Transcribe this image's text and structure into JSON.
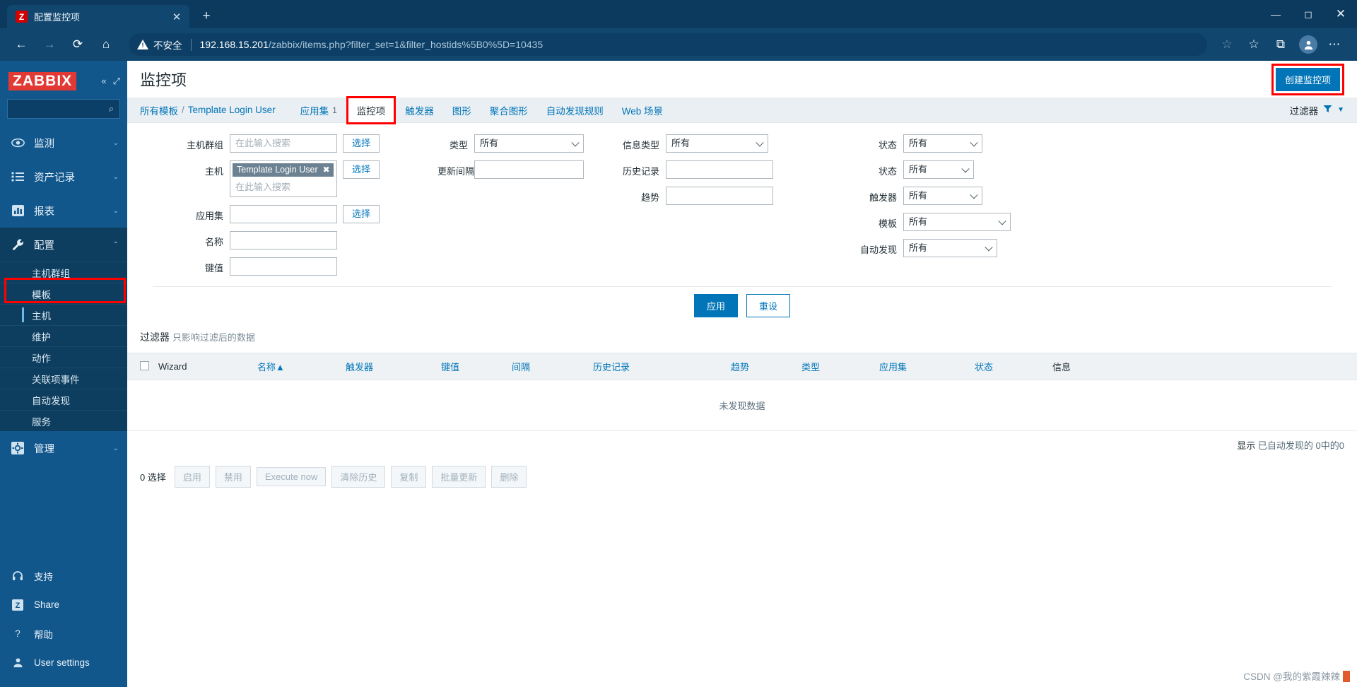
{
  "browser": {
    "tab": {
      "title": "配置监控项",
      "favicon_text": "Z",
      "close_icon": "✕"
    },
    "new_tab_icon": "+",
    "window_controls": {
      "minimize": "—",
      "maximize": "◻",
      "close": "✕"
    },
    "nav": {
      "back": "←",
      "forward": "→",
      "reload": "⟳",
      "home": "⌂"
    },
    "security": {
      "label": "不安全"
    },
    "url": {
      "host": "192.168.15.201",
      "path": "/zabbix/items.php?filter_set=1&filter_hostids%5B0%5D=10435"
    },
    "right_icons": {
      "add_favorite": "☆",
      "favorites": "☆",
      "collections": "⧉",
      "profile": "●",
      "settings": "⋯"
    }
  },
  "sidebar": {
    "logo": "ZABBIX",
    "collapse_icon": "«",
    "expand_icon": "⤢",
    "search_placeholder": "",
    "search_icon": "⌕",
    "items": [
      {
        "label": "监测",
        "icon": "eye-icon",
        "glyph": "◉",
        "chevron": "⌄"
      },
      {
        "label": "资产记录",
        "icon": "list-icon",
        "glyph": "☰",
        "chevron": "⌄"
      },
      {
        "label": "报表",
        "icon": "chart-icon",
        "glyph": "▥",
        "chevron": "⌄"
      },
      {
        "label": "配置",
        "icon": "wrench-icon",
        "glyph": "🔧",
        "chevron": "⌃"
      }
    ],
    "sub_items": [
      {
        "label": "主机群组"
      },
      {
        "label": "模板"
      },
      {
        "label": "主机"
      },
      {
        "label": "维护"
      },
      {
        "label": "动作"
      },
      {
        "label": "关联项事件"
      },
      {
        "label": "自动发现"
      },
      {
        "label": "服务"
      }
    ],
    "admin": {
      "label": "管理",
      "icon": "gear-icon",
      "glyph": "⚙",
      "chevron": "⌄"
    },
    "bottom_items": [
      {
        "label": "支持",
        "icon": "headset-icon",
        "glyph": "🎧"
      },
      {
        "label": "Share",
        "icon": "zabbix-share-icon",
        "glyph": "Z"
      },
      {
        "label": "帮助",
        "icon": "question-icon",
        "glyph": "?"
      },
      {
        "label": "User settings",
        "icon": "user-icon",
        "glyph": "👤"
      }
    ]
  },
  "header": {
    "title": "监控项",
    "create_button": "创建监控项"
  },
  "nav": {
    "breadcrumb_root": "所有模板",
    "breadcrumb_sep": "/",
    "breadcrumb_current": "Template Login User",
    "tabs": [
      {
        "label": "应用集",
        "count": "1"
      },
      {
        "label": "监控项",
        "count": ""
      },
      {
        "label": "触发器",
        "count": ""
      },
      {
        "label": "图形",
        "count": ""
      },
      {
        "label": "聚合图形",
        "count": ""
      },
      {
        "label": "自动发现规则",
        "count": ""
      },
      {
        "label": "Web 场景",
        "count": ""
      }
    ],
    "filter_toggle": "过滤器",
    "filter_icon": "▼"
  },
  "filter": {
    "hostgroup": {
      "label": "主机群组",
      "placeholder": "在此输入搜索",
      "value": "",
      "select_button": "选择"
    },
    "host": {
      "label": "主机",
      "chip": "Template Login User",
      "chip_remove": "✖",
      "placeholder": "在此输入搜索",
      "select_button": "选择"
    },
    "appset": {
      "label": "应用集",
      "value": "",
      "select_button": "选择"
    },
    "name": {
      "label": "名称",
      "value": ""
    },
    "key": {
      "label": "键值",
      "value": ""
    },
    "type": {
      "label": "类型",
      "value": "所有"
    },
    "update_interval": {
      "label": "更新间隔",
      "value": ""
    },
    "info_type": {
      "label": "信息类型",
      "value": "所有"
    },
    "history": {
      "label": "历史记录",
      "value": ""
    },
    "trends": {
      "label": "趋势",
      "value": ""
    },
    "state": {
      "label": "状态",
      "value": "所有"
    },
    "status": {
      "label": "状态",
      "value": "所有"
    },
    "trigger": {
      "label": "触发器",
      "value": "所有"
    },
    "template": {
      "label": "模板",
      "value": "所有"
    },
    "discovery": {
      "label": "自动发现",
      "value": "所有"
    },
    "apply_button": "应用",
    "reset_button": "重设",
    "note_strong": "过滤器",
    "note_muted": "只影响过滤后的数据"
  },
  "table": {
    "columns": [
      {
        "label": "Wizard",
        "sortable": false
      },
      {
        "label": "名称",
        "sort_marker": "▲",
        "sortable": true
      },
      {
        "label": "触发器",
        "sortable": true
      },
      {
        "label": "键值",
        "sortable": true
      },
      {
        "label": "间隔",
        "sortable": true
      },
      {
        "label": "历史记录",
        "sortable": true
      },
      {
        "label": "趋势",
        "sortable": true
      },
      {
        "label": "类型",
        "sortable": true
      },
      {
        "label": "应用集",
        "sortable": true
      },
      {
        "label": "状态",
        "sortable": true
      },
      {
        "label": "信息",
        "sortable": false
      }
    ],
    "empty_message": "未发现数据",
    "footer_label": "显示",
    "footer_value": "已自动发现的 0中的0"
  },
  "actions": {
    "selection": "0 选择",
    "buttons": [
      "启用",
      "禁用",
      "Execute now",
      "清除历史",
      "复制",
      "批量更新",
      "删除"
    ]
  },
  "watermark": "CSDN @我的紫霞辣辣"
}
